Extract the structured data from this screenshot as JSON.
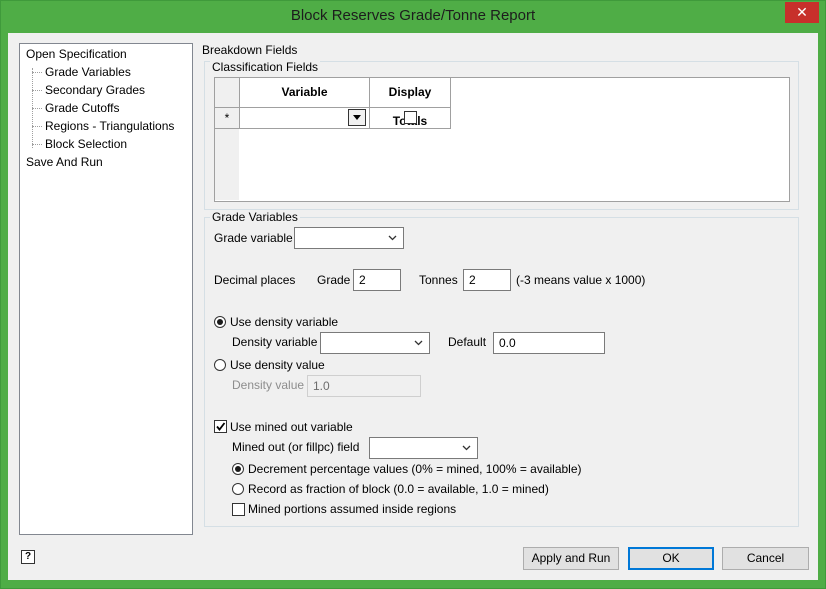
{
  "window": {
    "title": "Block Reserves Grade/Tonne Report",
    "close": "✕"
  },
  "tree": {
    "items": [
      {
        "label": "Open Specification"
      },
      {
        "label": "Grade Variables"
      },
      {
        "label": "Secondary Grades"
      },
      {
        "label": "Grade Cutoffs"
      },
      {
        "label": "Regions - Triangulations"
      },
      {
        "label": "Block Selection"
      },
      {
        "label": "Save And Run"
      }
    ]
  },
  "breakdown": {
    "label": "Breakdown Fields",
    "classification": {
      "label": "Classification Fields",
      "columns": [
        "Variable",
        "Display Totals"
      ],
      "new_row_marker": "*"
    }
  },
  "grade": {
    "label": "Grade Variables",
    "grade_variable_label": "Grade variable",
    "grade_variable_value": "",
    "decimal_places_label": "Decimal places",
    "grade_label": "Grade",
    "grade_value": "2",
    "tonnes_label": "Tonnes",
    "tonnes_value": "2",
    "note": "(-3 means value x 1000)",
    "use_density_variable": "Use density variable",
    "density_variable_label": "Density variable",
    "density_variable_value": "",
    "default_label": "Default",
    "default_value": "0.0",
    "use_density_value": "Use density value",
    "density_value_label": "Density value",
    "density_value": "1.0",
    "use_mined_out": "Use mined out variable",
    "mined_field_label": "Mined out (or fillpc) field",
    "mined_field_value": "",
    "decrement_label": "Decrement percentage values (0% = mined, 100% = available)",
    "fraction_label": "Record as fraction of block (0.0 = available, 1.0 = mined)",
    "inside_regions_label": "Mined portions assumed inside regions"
  },
  "buttons": {
    "help": "?",
    "apply_run": "Apply and Run",
    "ok": "OK",
    "cancel": "Cancel"
  },
  "colors": {
    "titlebar": "#4fad46",
    "close": "#c7302b",
    "accent": "#0078d7"
  }
}
